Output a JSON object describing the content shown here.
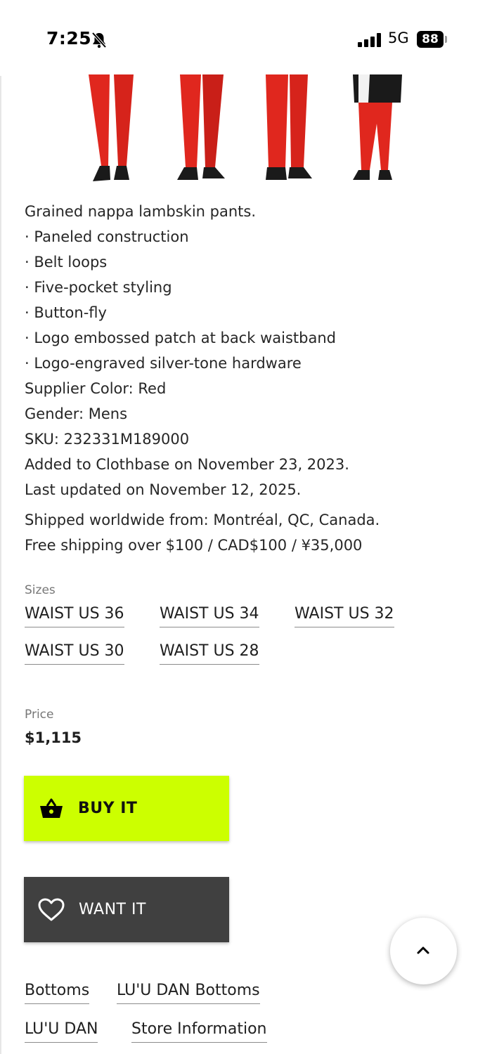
{
  "status_bar": {
    "time": "7:25",
    "network": "5G",
    "battery": "88"
  },
  "product": {
    "image_alt": "Red leather pants",
    "description_lines": [
      "Grained nappa lambskin pants.",
      "· Paneled construction",
      "· Belt loops",
      "· Five-pocket styling",
      "· Button-fly",
      "· Logo embossed patch at back waistband",
      "· Logo-engraved silver-tone hardware",
      "Supplier Color: Red",
      "Gender: Mens",
      "SKU: 232331M189000",
      "Added to Clothbase on November 23, 2023.",
      "Last updated on November 12, 2025."
    ],
    "shipping_lines": [
      "Shipped worldwide from: Montréal, QC, Canada.",
      "Free shipping over $100 / CAD$100 / ¥35,000"
    ]
  },
  "sizes": {
    "label": "Sizes",
    "options": [
      "WAIST US 36",
      "WAIST US 34",
      "WAIST US 32",
      "WAIST US 30",
      "WAIST US 28"
    ]
  },
  "price": {
    "label": "Price",
    "value": "$1,115"
  },
  "actions": {
    "buy_label": "BUY IT",
    "want_label": "WANT IT"
  },
  "categories": [
    "Bottoms",
    "LU'U DAN Bottoms",
    "LU'U DAN",
    "Store Information"
  ],
  "colors": {
    "buy_button": "#ccff00",
    "want_button": "#404040",
    "product_red": "#e0271e"
  },
  "icons": {
    "buy": "basket-icon",
    "want": "heart-icon",
    "top": "chevron-up-icon"
  }
}
